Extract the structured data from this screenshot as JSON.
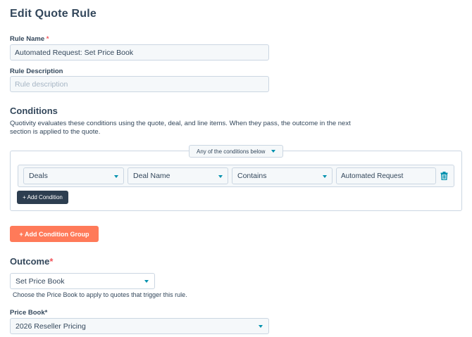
{
  "page": {
    "title": "Edit Quote Rule"
  },
  "rule_name": {
    "label": "Rule Name",
    "required_mark": "*",
    "value": "Automated Request: Set Price Book"
  },
  "rule_description": {
    "label": "Rule Description",
    "placeholder": "Rule description"
  },
  "conditions": {
    "title": "Conditions",
    "help_line1": "Quotivity evaluates these conditions using the quote, deal, and line items. When they pass, the outcome in the next",
    "help_line2": "section is applied to the quote.",
    "logic_select": "Any of the conditions below",
    "row": {
      "object": "Deals",
      "property": "Deal Name",
      "operator": "Contains",
      "value": "Automated Request"
    },
    "add_condition_label": "+ Add Condition",
    "add_group_label": "+ Add Condition Group"
  },
  "outcome": {
    "title": "Outcome",
    "required_mark": "*",
    "selected": "Set Price Book",
    "help": "Choose the Price Book to apply to quotes that trigger this rule."
  },
  "price_book": {
    "label": "Price Book*",
    "selected": "2026 Reseller Pricing"
  },
  "colors": {
    "accent": "#0091ae",
    "primary_dark": "#2d3e50",
    "orange": "#ff7a59",
    "required": "#f2545b"
  },
  "icons": {
    "caret": "chevron-down-icon",
    "delete": "trash-icon"
  }
}
